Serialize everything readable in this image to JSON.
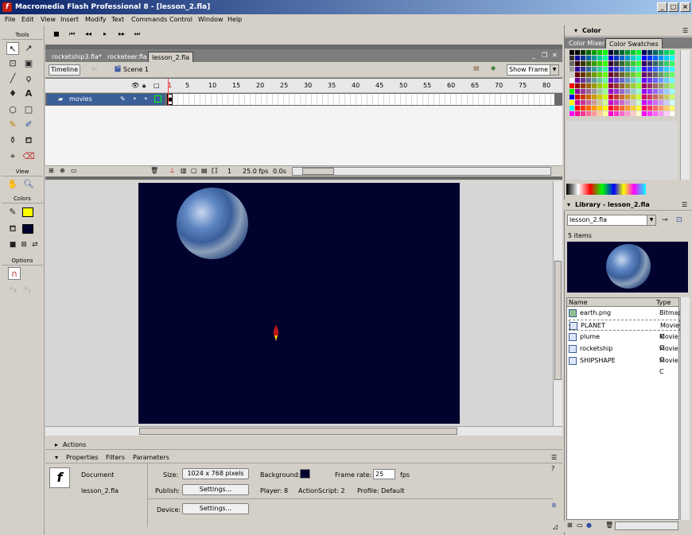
{
  "app": {
    "title": "Macromedia Flash Professional 8 - [lesson_2.fla]"
  },
  "window_buttons": {
    "minimize": "_",
    "maximize": "□",
    "close": "×"
  },
  "menu": [
    "File",
    "Edit",
    "View",
    "Insert",
    "Modify",
    "Text",
    "Commands",
    "Control",
    "Window",
    "Help"
  ],
  "tools": {
    "title": "Tools",
    "view_label": "View",
    "colors_label": "Colors",
    "options_label": "Options"
  },
  "document_tabs": [
    "rocketship3.fla*",
    "rocketeer.fla",
    "lesson_2.fla"
  ],
  "timeline_bar": {
    "timeline_button": "Timeline",
    "scene": "Scene 1",
    "zoom": "Show Frame"
  },
  "timeline": {
    "frame_numbers": [
      "1",
      "5",
      "10",
      "15",
      "20",
      "25",
      "30",
      "35",
      "40",
      "45",
      "50",
      "55",
      "60",
      "65",
      "70",
      "75",
      "80"
    ],
    "layer_name": "movies",
    "current_frame": "1",
    "fps": "25.0 fps",
    "elapsed": "0.0s"
  },
  "panels": {
    "actions": "Actions",
    "properties_tabs": [
      "Properties",
      "Filters",
      "Parameters"
    ]
  },
  "properties": {
    "doc_label": "Document",
    "doc_name": "lesson_2.fla",
    "size_label": "Size:",
    "size_value": "1024 x 768 pixels",
    "background_label": "Background:",
    "frame_rate_label": "Frame rate:",
    "frame_rate_value": "25",
    "fps_unit": "fps",
    "publish_label": "Publish:",
    "settings_label": "Settings...",
    "player": "Player: 8",
    "actionscript": "ActionScript: 2",
    "profile": "Profile: Default",
    "device_label": "Device:",
    "device_settings": "Settings..."
  },
  "color_panel": {
    "title": "Color",
    "tabs": [
      "Color Mixer",
      "Color Swatches"
    ]
  },
  "library": {
    "title": "Library - lesson_2.fla",
    "selected_doc": "lesson_2.fla",
    "count": "5 items",
    "columns": [
      "Name",
      "Type"
    ],
    "items": [
      {
        "name": "earth.png",
        "type": "Bitmap"
      },
      {
        "name": "PLANET",
        "type": "Movie C"
      },
      {
        "name": "plume",
        "type": "Movie C"
      },
      {
        "name": "rocketship",
        "type": "Movie C"
      },
      {
        "name": "SHIPSHAPE",
        "type": "Movie C"
      }
    ]
  },
  "colors": {
    "stage_bg": "#01032e",
    "title_start": "#0a246a",
    "layer_selected": "#3a5f99"
  }
}
